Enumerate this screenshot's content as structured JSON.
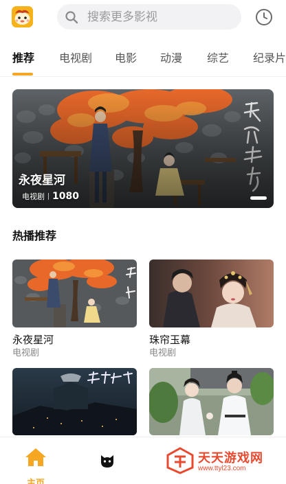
{
  "header": {
    "search_placeholder": "搜索更多影视",
    "logo_icon": "cartoon-face-logo-icon",
    "history_icon": "clock-icon"
  },
  "tabs": [
    {
      "label": "推荐",
      "active": true
    },
    {
      "label": "电视剧",
      "active": false
    },
    {
      "label": "电影",
      "active": false
    },
    {
      "label": "动漫",
      "active": false
    },
    {
      "label": "综艺",
      "active": false
    },
    {
      "label": "纪录片",
      "active": false
    }
  ],
  "banner": {
    "title": "永夜星河",
    "genre": "电视剧",
    "count": "1080"
  },
  "section": {
    "title": "热播推荐"
  },
  "cards": [
    {
      "title": "永夜星河",
      "subtitle": "电视剧"
    },
    {
      "title": "珠帘玉幕",
      "subtitle": "电视剧"
    }
  ],
  "bottom_nav": {
    "home_label": "主页",
    "home_icon": "home-icon",
    "mine_icon": "cat-face-icon"
  },
  "watermark": {
    "text": "天天游戏网",
    "url": "www.ttyl23.com"
  },
  "colors": {
    "accent": "#f5a623",
    "watermark": "#e84a2f"
  }
}
